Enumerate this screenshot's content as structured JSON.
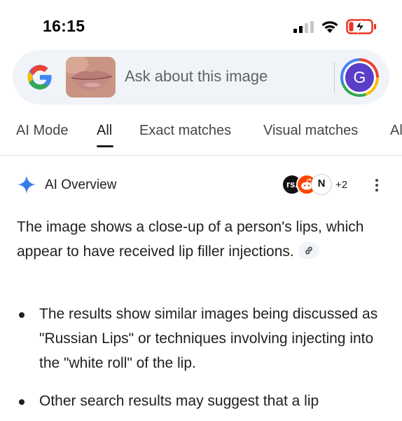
{
  "status_bar": {
    "time": "16:15",
    "icons": [
      "cellular-signal-icon",
      "wifi-icon",
      "battery-charging-icon"
    ]
  },
  "search": {
    "placeholder": "Ask about this image",
    "avatar_letter": "G",
    "logo": "google-g-logo",
    "thumbnail": "lips-image-thumbnail"
  },
  "tabs": [
    {
      "label": "AI Mode",
      "active": false
    },
    {
      "label": "All",
      "active": true
    },
    {
      "label": "Exact matches",
      "active": false
    },
    {
      "label": "Visual matches",
      "active": false
    },
    {
      "label": "Al",
      "active": false
    }
  ],
  "ai_overview": {
    "title": "AI Overview",
    "sources": [
      {
        "label": "rs.",
        "color": "#111111"
      },
      {
        "label": "",
        "icon": "reddit-icon",
        "color": "#ff4500"
      },
      {
        "label": "N",
        "color": "#ffffff"
      }
    ],
    "more_sources": "+2",
    "summary": "The image shows a close-up of a person's lips, which appear to have received lip filler injections.",
    "bullets": [
      "The results show similar images being discussed as \"Russian Lips\" or techniques involving injecting into the \"white roll\" of the lip.",
      "Other search results may suggest that a lip"
    ]
  },
  "colors": {
    "search_bg": "#f0f4f9",
    "spark_blue": "#4285f4",
    "battery_red": "#ea3323",
    "avatar_purple": "#5b3ec8"
  }
}
